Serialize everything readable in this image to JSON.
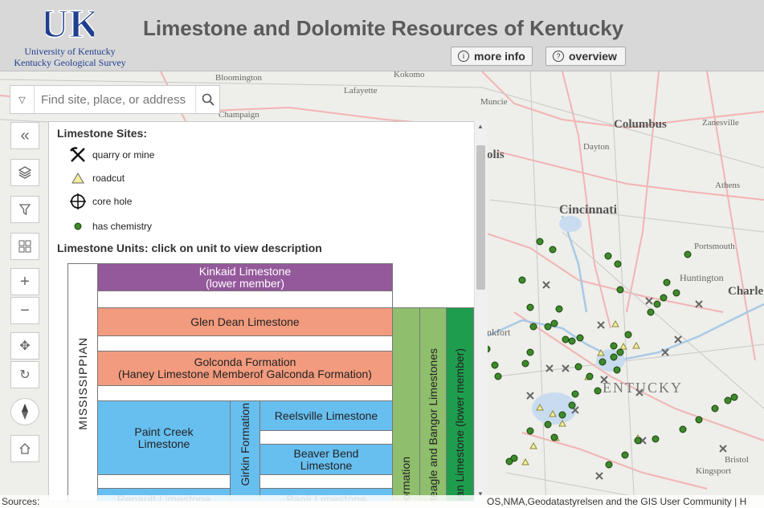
{
  "header": {
    "logo_mark": "UK",
    "logo_line1": "University of Kentucky",
    "logo_line2": "Kentucky Geological Survey",
    "title": "Limestone and Dolomite Resources of Kentucky",
    "more_info_label": "more info",
    "overview_label": "overview"
  },
  "search": {
    "placeholder": "Find site, place, or address"
  },
  "map_labels": {
    "bloomington": "Bloomington",
    "kokomo": "Kokomo",
    "lafayette": "Lafayette",
    "muncie": "Muncie",
    "champaign": "Champaign",
    "columbus": "Columbus",
    "zanesville": "Zanesville",
    "dayton": "Dayton",
    "athens": "Athens",
    "cincinnati": "Cincinnati",
    "portsmouth": "Portsmouth",
    "huntington": "Huntington",
    "charleston": "Charle",
    "frankfort": "nkfort",
    "kentucky": "ENTUCKY",
    "bristol": "Bristol",
    "kingsport": "Kingsport",
    "polis": "olis"
  },
  "legend": {
    "sites_title": "Limestone Sites:",
    "site_items": [
      "quarry or mine",
      "roadcut",
      "core hole",
      "has chemistry"
    ],
    "units_title": "Limestone Units: click on unit to view description",
    "period_label": "MISSISSIPPIAN",
    "units": {
      "kinkaid": "Kinkaid Limestone\n(lower member)",
      "glen_dean": "Glen Dean Limestone",
      "golconda": "Golconda Formation\n(Haney Limestone Memberof Galconda Formation)",
      "paint_creek": "Paint Creek\nLimestone",
      "girkin": "Girkin Formation",
      "reelsville": "Reelsville Limestone",
      "beaver_bend": "Beaver Bend\nLimestone",
      "renault": "Renault Limestone",
      "paoli": "Paoli Limestone",
      "formation_col": "Formation",
      "bangor_col": "nteagle and Bangor Limestones",
      "lower_member_col": "man Limestone  (lower member)"
    },
    "colors": {
      "purple": "#94599b",
      "salmon": "#f39b7e",
      "blue": "#67bff0",
      "green": "#8fbf6c",
      "darkgreen": "#1f9d4e"
    }
  },
  "footer": {
    "sources_label": "Sources:",
    "credits": "OS,NMA,Geodatastyrelsen and the GIS User Community | H"
  },
  "icons": {
    "collapse": "double-chevron-left-icon",
    "layers": "layers-icon",
    "filter": "filter-icon",
    "basemap": "grid-icon",
    "zoom_in": "plus-icon",
    "zoom_out": "minus-icon",
    "pan": "move-icon",
    "refresh": "rotate-icon",
    "compass": "compass-icon",
    "home": "home-icon"
  }
}
